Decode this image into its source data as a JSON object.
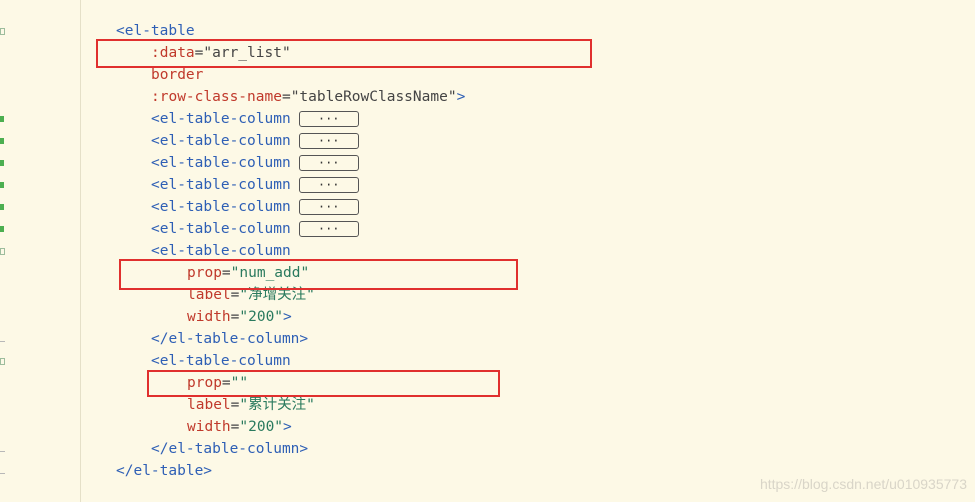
{
  "lines": [
    [
      {
        "t": "<el-table",
        "c": "tag"
      }
    ],
    [
      {
        "t": ":data",
        "c": "attr"
      },
      {
        "t": "=",
        "c": "punct"
      },
      {
        "t": "\"arr_list\"",
        "c": "punct"
      }
    ],
    [
      {
        "t": "border",
        "c": "attr"
      }
    ],
    [
      {
        "t": ":row-class-name",
        "c": "attr"
      },
      {
        "t": "=",
        "c": "punct"
      },
      {
        "t": "\"tableRowClassName\"",
        "c": "punct"
      },
      {
        "t": ">",
        "c": "tag"
      }
    ],
    [
      {
        "t": "<el-table-column",
        "c": "tag"
      },
      {
        "t": "···",
        "c": "fold"
      }
    ],
    [
      {
        "t": "<el-table-column",
        "c": "tag"
      },
      {
        "t": "···",
        "c": "fold"
      }
    ],
    [
      {
        "t": "<el-table-column",
        "c": "tag"
      },
      {
        "t": "···",
        "c": "fold"
      }
    ],
    [
      {
        "t": "<el-table-column",
        "c": "tag"
      },
      {
        "t": "···",
        "c": "fold"
      }
    ],
    [
      {
        "t": "<el-table-column",
        "c": "tag"
      },
      {
        "t": "···",
        "c": "fold"
      }
    ],
    [
      {
        "t": "<el-table-column",
        "c": "tag"
      },
      {
        "t": "···",
        "c": "fold"
      }
    ],
    [
      {
        "t": "<el-table-column",
        "c": "tag"
      }
    ],
    [
      {
        "t": "prop",
        "c": "attr"
      },
      {
        "t": "=",
        "c": "punct"
      },
      {
        "t": "\"num_add\"",
        "c": "str"
      }
    ],
    [
      {
        "t": "label",
        "c": "attr"
      },
      {
        "t": "=",
        "c": "punct"
      },
      {
        "t": "\"净增关注\"",
        "c": "str"
      }
    ],
    [
      {
        "t": "width",
        "c": "attr"
      },
      {
        "t": "=",
        "c": "punct"
      },
      {
        "t": "\"200\"",
        "c": "str"
      },
      {
        "t": ">",
        "c": "tag"
      }
    ],
    [
      {
        "t": "</el-table-column>",
        "c": "tag"
      }
    ],
    [
      {
        "t": "<el-table-column",
        "c": "tag"
      }
    ],
    [
      {
        "t": "prop",
        "c": "attr"
      },
      {
        "t": "=",
        "c": "punct"
      },
      {
        "t": "\"\"",
        "c": "str"
      }
    ],
    [
      {
        "t": "label",
        "c": "attr"
      },
      {
        "t": "=",
        "c": "punct"
      },
      {
        "t": "\"累计关注\"",
        "c": "str"
      }
    ],
    [
      {
        "t": "width",
        "c": "attr"
      },
      {
        "t": "=",
        "c": "punct"
      },
      {
        "t": "\"200\"",
        "c": "str"
      },
      {
        "t": ">",
        "c": "tag"
      }
    ],
    [
      {
        "t": "</el-table-column>",
        "c": "tag"
      }
    ],
    [
      {
        "t": "</el-table>",
        "c": "tag"
      }
    ]
  ],
  "watermark": "https://blog.csdn.net/u010935773",
  "colors": {
    "background": "#fdf9e6",
    "tag": "#2e5fb5",
    "attribute": "#c0392b",
    "string": "#2a7a5e",
    "highlight": "#e0302e",
    "gutter_change": "#4caf50"
  }
}
